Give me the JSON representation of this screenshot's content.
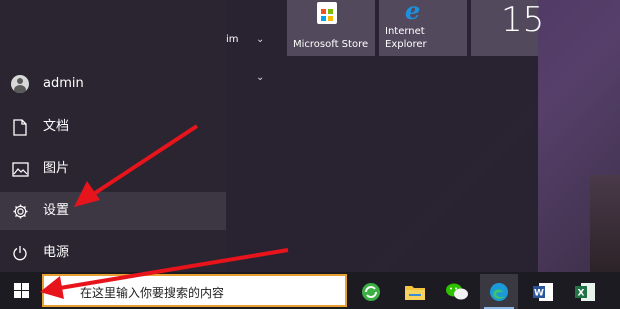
{
  "start_menu": {
    "user": {
      "name": "admin",
      "icon": "avatar"
    },
    "rail": [
      {
        "id": "documents",
        "label": "文档",
        "icon": "document-icon"
      },
      {
        "id": "pictures",
        "label": "图片",
        "icon": "picture-icon"
      },
      {
        "id": "settings",
        "label": "设置",
        "icon": "gear-icon"
      },
      {
        "id": "power",
        "label": "电源",
        "icon": "power-icon"
      }
    ],
    "app_list": {
      "partial_label": "im"
    },
    "tiles": [
      {
        "id": "store",
        "label": "Microsoft Store",
        "icon": "microsoft-store-icon"
      },
      {
        "id": "ie",
        "label_line1": "Internet",
        "label_line2": "Explorer",
        "icon": "internet-explorer-icon",
        "glyph": "e"
      },
      {
        "id": "calendar",
        "value": "15",
        "icon": "calendar-date"
      }
    ]
  },
  "taskbar": {
    "search_placeholder": "在这里输入你要搜索的内容",
    "apps": [
      {
        "id": "browser",
        "icon": "browser-icon"
      },
      {
        "id": "file-explorer",
        "icon": "folder-icon"
      },
      {
        "id": "wechat",
        "icon": "wechat-icon"
      },
      {
        "id": "edge",
        "icon": "edge-icon"
      },
      {
        "id": "word",
        "icon": "word-icon",
        "glyph": "W"
      },
      {
        "id": "excel",
        "icon": "excel-icon",
        "glyph": "X"
      }
    ]
  },
  "colors": {
    "accent_orange": "#e8a030",
    "annotation_red": "#e8141c",
    "taskbar": "#1d1b22",
    "rail_active": "#3d3744"
  }
}
